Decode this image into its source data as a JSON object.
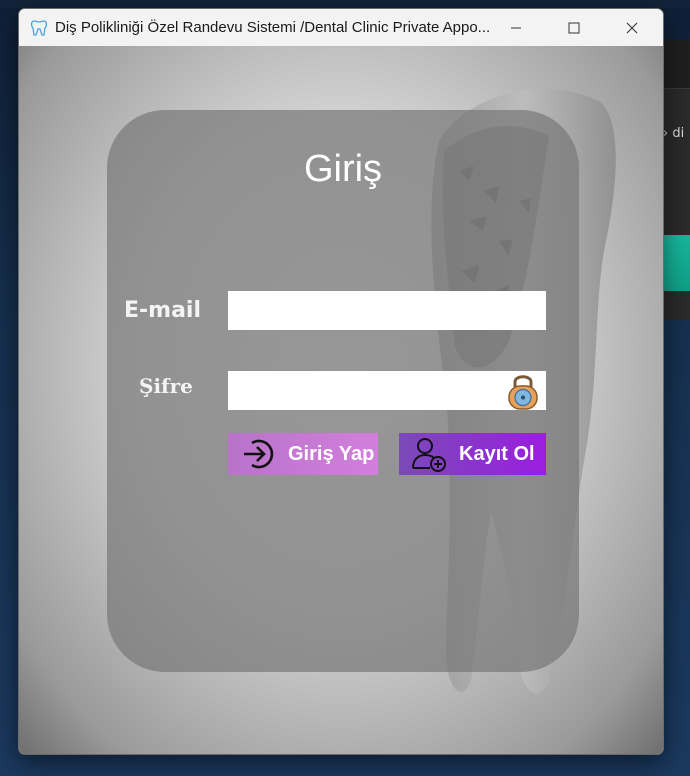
{
  "window": {
    "title": "Diş Polikliniği Özel Randevu Sistemi /Dental Clinic Private Appo...",
    "controls": [
      "minimize",
      "maximize",
      "close"
    ]
  },
  "background_app": {
    "fragment_text": "di"
  },
  "login": {
    "heading": "Giriş",
    "email_label": "E-mail",
    "email_value": "",
    "password_label": "Şifre",
    "password_value": "",
    "login_button": "Giriş Yap",
    "register_button": "Kayıt Ol"
  },
  "icons": {
    "app": "tooth-icon",
    "password_field": "padlock-icon",
    "login_button": "login-arrow-icon",
    "register_button": "add-user-icon"
  },
  "colors": {
    "login_button": "#c97ad5",
    "register_button": "#9a1ee0",
    "panel": "#787878"
  }
}
